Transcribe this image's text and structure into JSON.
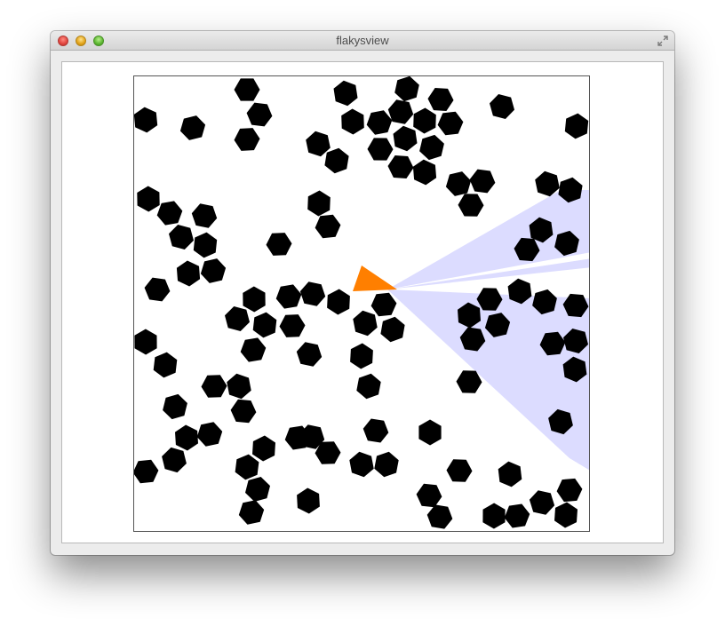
{
  "window": {
    "title": "flakysview"
  },
  "icons": {
    "close": "close-traffic-light-icon",
    "minimize": "minimize-traffic-light-icon",
    "maximize": "zoom-traffic-light-icon",
    "fullscreen": "fullscreen-arrows-icon"
  },
  "colors": {
    "obstacle": "#000000",
    "agent": "#ff7f00",
    "sensor_field": "#dcdcff",
    "canvas_background": "#ffffff"
  },
  "scene": {
    "obstacle_shape": "hexagon",
    "agent_shape": "triangle",
    "sensor_shape": "vision-cone"
  }
}
